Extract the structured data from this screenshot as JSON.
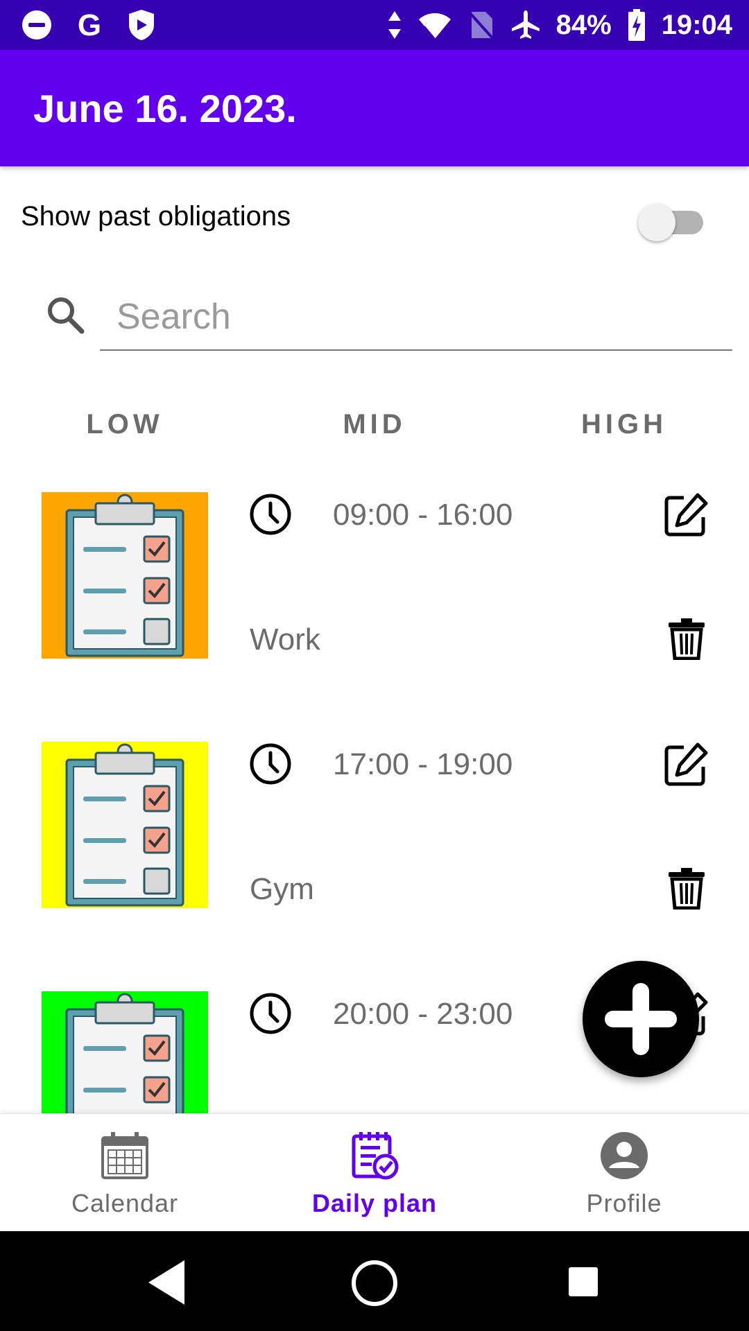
{
  "status_bar": {
    "battery": "84%",
    "time": "19:04",
    "left_icons": [
      "dnd-icon",
      "google-icon",
      "shield-icon"
    ],
    "right_icons": [
      "data-arrows-icon",
      "wifi-icon",
      "no-sim-icon",
      "airplane-icon",
      "battery-charging-icon"
    ]
  },
  "app_bar": {
    "title": "June 16. 2023.",
    "color": "#6200ee"
  },
  "toggle": {
    "label": "Show past obligations",
    "checked": false
  },
  "search": {
    "placeholder": "Search",
    "value": ""
  },
  "priority_tabs": [
    {
      "label": "LOW"
    },
    {
      "label": "MID"
    },
    {
      "label": "HIGH"
    }
  ],
  "obligations": [
    {
      "time": "09:00 - 16:00",
      "name": "Work",
      "color": "#ffa500"
    },
    {
      "time": "17:00 - 19:00",
      "name": "Gym",
      "color": "#ffff00"
    },
    {
      "time": "20:00 - 23:00",
      "name": "",
      "color": "#00ff00"
    }
  ],
  "bottom_nav": [
    {
      "label": "Calendar",
      "icon": "calendar-icon",
      "active": false
    },
    {
      "label": "Daily plan",
      "icon": "daily-plan-icon",
      "active": true
    },
    {
      "label": "Profile",
      "icon": "profile-icon",
      "active": false
    }
  ],
  "system_nav": [
    "back-icon",
    "home-icon",
    "recents-icon"
  ],
  "accent_color": "#6200ee"
}
